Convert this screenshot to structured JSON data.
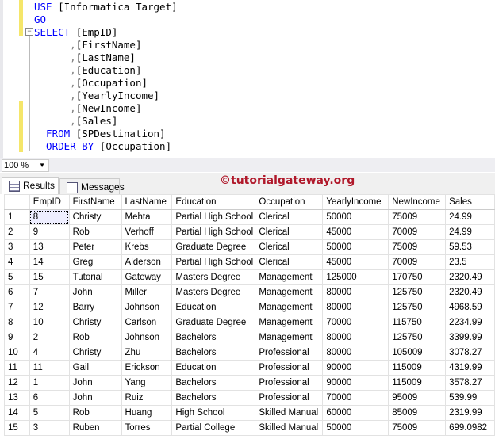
{
  "editor": {
    "lines": [
      [
        {
          "t": "USE ",
          "c": "kw"
        },
        {
          "t": "[Informatica Target]"
        }
      ],
      [
        {
          "t": "GO",
          "c": "kw"
        }
      ],
      [
        {
          "t": "SELECT ",
          "c": "kw"
        },
        {
          "t": "[EmpID]"
        }
      ],
      [
        {
          "t": "      ,",
          "c": "gr"
        },
        {
          "t": "[FirstName]"
        }
      ],
      [
        {
          "t": "      ,",
          "c": "gr"
        },
        {
          "t": "[LastName]"
        }
      ],
      [
        {
          "t": "      ,",
          "c": "gr"
        },
        {
          "t": "[Education]"
        }
      ],
      [
        {
          "t": "      ,",
          "c": "gr"
        },
        {
          "t": "[Occupation]"
        }
      ],
      [
        {
          "t": "      ,",
          "c": "gr"
        },
        {
          "t": "[YearlyIncome]"
        }
      ],
      [
        {
          "t": "      ,",
          "c": "gr"
        },
        {
          "t": "[NewIncome]"
        }
      ],
      [
        {
          "t": "      ,",
          "c": "gr"
        },
        {
          "t": "[Sales]"
        }
      ],
      [
        {
          "t": "  FROM ",
          "c": "kw"
        },
        {
          "t": "[SPDestination]"
        }
      ],
      [
        {
          "t": "  ORDER BY ",
          "c": "kw"
        },
        {
          "t": "[Occupation]"
        }
      ]
    ]
  },
  "zoom": "100 %",
  "tabs": {
    "results": "Results",
    "messages": "Messages"
  },
  "watermark": "©tutorialgateway.org",
  "grid": {
    "columns": [
      "",
      "EmpID",
      "FirstName",
      "LastName",
      "Education",
      "Occupation",
      "YearlyIncome",
      "NewIncome",
      "Sales"
    ],
    "rows": [
      [
        "1",
        "8",
        "Christy",
        "Mehta",
        "Partial High School",
        "Clerical",
        "50000",
        "75009",
        "24.99"
      ],
      [
        "2",
        "9",
        "Rob",
        "Verhoff",
        "Partial High School",
        "Clerical",
        "45000",
        "70009",
        "24.99"
      ],
      [
        "3",
        "13",
        "Peter",
        "Krebs",
        "Graduate Degree",
        "Clerical",
        "50000",
        "75009",
        "59.53"
      ],
      [
        "4",
        "14",
        "Greg",
        "Alderson",
        "Partial High School",
        "Clerical",
        "45000",
        "70009",
        "23.5"
      ],
      [
        "5",
        "15",
        "Tutorial",
        "Gateway",
        "Masters Degree",
        "Management",
        "125000",
        "170750",
        "2320.49"
      ],
      [
        "6",
        "7",
        "John",
        "Miller",
        "Masters Degree",
        "Management",
        "80000",
        "125750",
        "2320.49"
      ],
      [
        "7",
        "12",
        "Barry",
        "Johnson",
        "Education",
        "Management",
        "80000",
        "125750",
        "4968.59"
      ],
      [
        "8",
        "10",
        "Christy",
        "Carlson",
        "Graduate Degree",
        "Management",
        "70000",
        "115750",
        "2234.99"
      ],
      [
        "9",
        "2",
        "Rob",
        "Johnson",
        "Bachelors",
        "Management",
        "80000",
        "125750",
        "3399.99"
      ],
      [
        "10",
        "4",
        "Christy",
        "Zhu",
        "Bachelors",
        "Professional",
        "80000",
        "105009",
        "3078.27"
      ],
      [
        "11",
        "11",
        "Gail",
        "Erickson",
        "Education",
        "Professional",
        "90000",
        "115009",
        "4319.99"
      ],
      [
        "12",
        "1",
        "John",
        "Yang",
        "Bachelors",
        "Professional",
        "90000",
        "115009",
        "3578.27"
      ],
      [
        "13",
        "6",
        "John",
        "Ruiz",
        "Bachelors",
        "Professional",
        "70000",
        "95009",
        "539.99"
      ],
      [
        "14",
        "5",
        "Rob",
        "Huang",
        "High School",
        "Skilled Manual",
        "60000",
        "85009",
        "2319.99"
      ],
      [
        "15",
        "3",
        "Ruben",
        "Torres",
        "Partial College",
        "Skilled Manual",
        "50000",
        "75009",
        "699.0982"
      ]
    ]
  }
}
